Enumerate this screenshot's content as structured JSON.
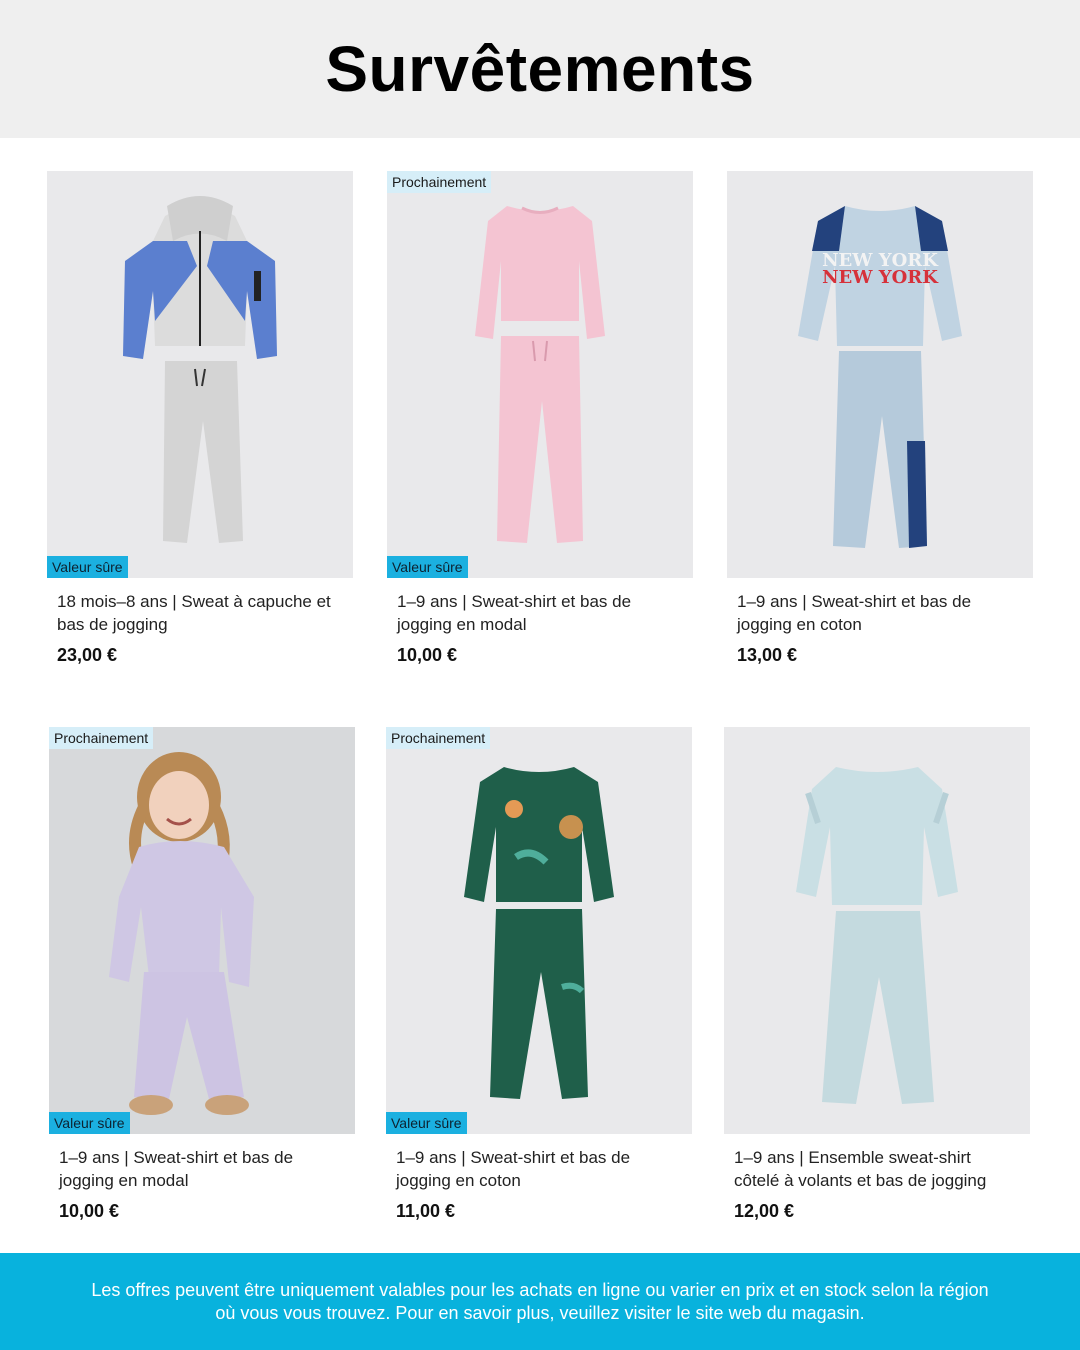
{
  "header": {
    "title": "Survêtements"
  },
  "badges": {
    "soon": "Prochainement",
    "value": "Valeur sûre"
  },
  "products": [
    {
      "title": "18 mois–8 ans | Sweat à capuche et bas de jogging",
      "price": "23,00 €",
      "badge_top": "",
      "badge_bottom": "Valeur sûre",
      "icon": "hoodie-jogger-set-image"
    },
    {
      "title": "1–9 ans | Sweat-shirt et bas de jogging en modal",
      "price": "10,00 €",
      "badge_top": "Prochainement",
      "badge_bottom": "Valeur sûre",
      "icon": "pink-sweatshirt-set-image"
    },
    {
      "title": "1–9 ans | Sweat-shirt et bas de jogging en coton",
      "price": "13,00 €",
      "badge_top": "",
      "badge_bottom": "",
      "icon": "new-york-sweatshirt-set-image"
    },
    {
      "title": "1–9 ans | Sweat-shirt et bas de jogging en modal",
      "price": "10,00 €",
      "badge_top": "Prochainement",
      "badge_bottom": "Valeur sûre",
      "icon": "girl-lilac-tracksuit-photo"
    },
    {
      "title": "1–9 ans | Sweat-shirt et bas de jogging en coton",
      "price": "11,00 €",
      "badge_top": "Prochainement",
      "badge_bottom": "Valeur sûre",
      "icon": "green-patch-sweatshirt-set-image"
    },
    {
      "title": "1–9 ans | Ensemble sweat-shirt côtelé à volants et bas de jogging",
      "price": "12,00 €",
      "badge_top": "",
      "badge_bottom": "",
      "icon": "ruffle-sweatshirt-set-image"
    }
  ],
  "print_text": {
    "ny1": "NEW YORK",
    "ny2": "NEW YORK"
  },
  "colors": {
    "accent": "#08b2dd",
    "badge_value": "#1bb0e0",
    "badge_soon": "#d6eef8",
    "header_bg": "#efefef"
  },
  "footer": {
    "text": "Les offres peuvent être uniquement valables pour les achats en ligne ou varier en prix et en stock selon la région où vous vous trouvez. Pour en savoir plus, veuillez visiter le site web du magasin."
  }
}
